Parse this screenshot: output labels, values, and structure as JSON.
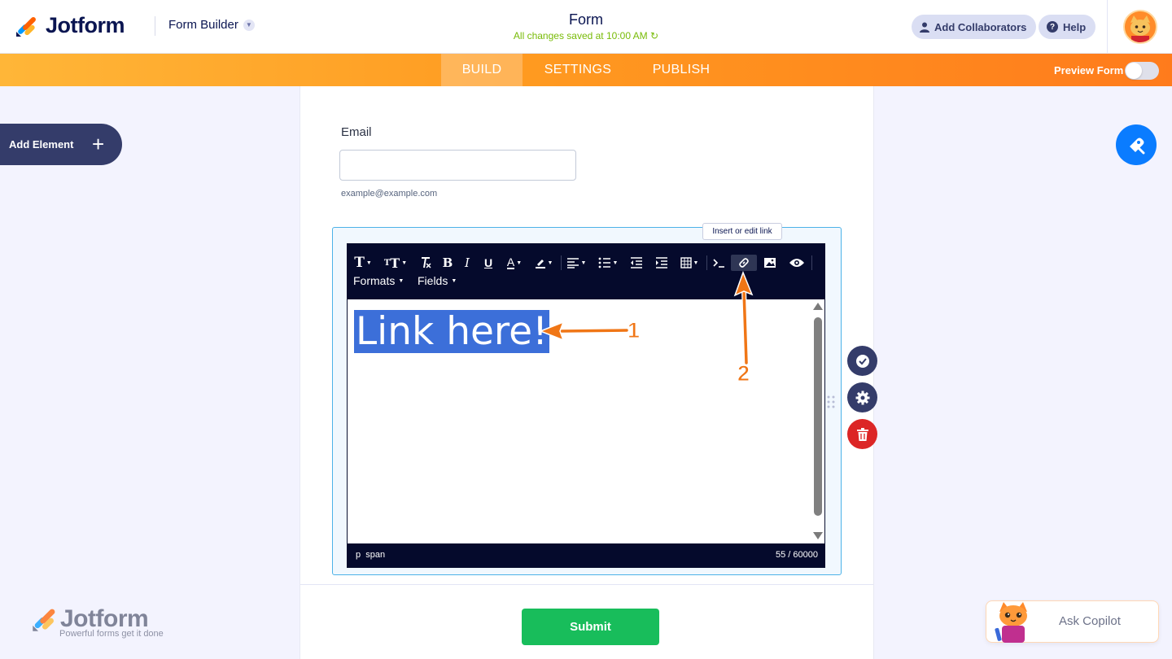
{
  "header": {
    "brand": "Jotform",
    "builder_menu": "Form Builder",
    "form_title": "Form",
    "saved_status": "All changes saved at 10:00 AM",
    "add_collaborators": "Add Collaborators",
    "help": "Help"
  },
  "nav": {
    "tabs": [
      {
        "label": "BUILD",
        "active": true
      },
      {
        "label": "SETTINGS",
        "active": false
      },
      {
        "label": "PUBLISH",
        "active": false
      }
    ],
    "preview_label": "Preview Form",
    "preview_on": false
  },
  "left_panel": {
    "add_element": "Add Element"
  },
  "form": {
    "email_label": "Email",
    "email_value": "",
    "email_hint": "example@example.com",
    "submit_label": "Submit"
  },
  "editor": {
    "toolbar_menus": [
      "Formats",
      "Fields"
    ],
    "toolbar_icons": [
      "font-family-icon",
      "font-size-icon",
      "clear-format-icon",
      "bold-icon",
      "italic-icon",
      "underline-icon",
      "text-color-icon",
      "highlight-icon",
      "align-icon",
      "list-icon",
      "outdent-icon",
      "indent-icon",
      "table-icon",
      "code-icon",
      "link-icon",
      "image-icon",
      "preview-icon"
    ],
    "tooltip": "Insert or edit link",
    "content": "Link here!",
    "path": "p  span",
    "char_count": "55 / 60000"
  },
  "annotations": {
    "arrow1_label": "1",
    "arrow2_label": "2"
  },
  "watermark": {
    "title": "Jotform",
    "tagline": "Powerful forms get it done"
  },
  "copilot": {
    "label": "Ask Copilot"
  },
  "colors": {
    "accent_orange": "#ff7b1c",
    "navy": "#0a1551",
    "editor_dark": "#050a2c",
    "selection": "#3c6fd9",
    "submit": "#18bd5b",
    "delete": "#dc2626",
    "designer_blue": "#0a7cff"
  }
}
